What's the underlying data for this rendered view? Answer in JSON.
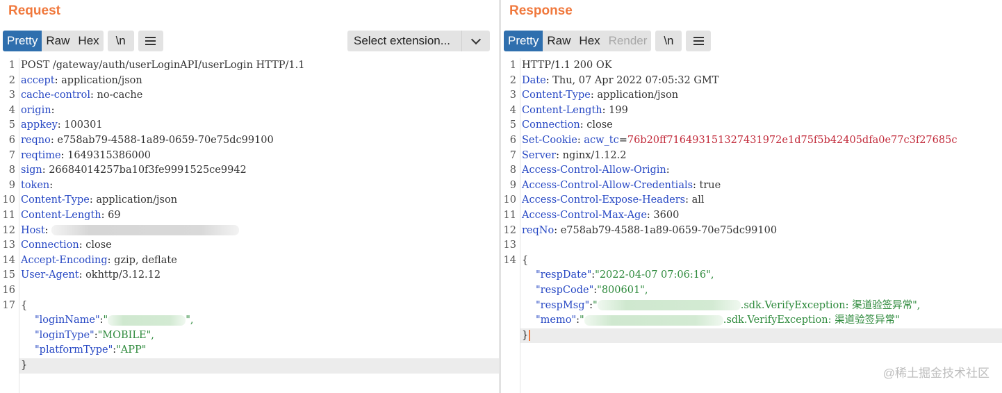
{
  "request": {
    "title": "Request",
    "tabs": [
      "Pretty",
      "Raw",
      "Hex"
    ],
    "newline_label": "\\n",
    "select_extension": "Select extension...",
    "lines": [
      {
        "n": "1",
        "text": "POST /gateway/auth/userLoginAPI/userLogin HTTP/1.1"
      },
      {
        "n": "2",
        "key": "accept",
        "val": " application/json"
      },
      {
        "n": "3",
        "key": "cache-control",
        "val": " no-cache"
      },
      {
        "n": "4",
        "key": "origin",
        "val": ""
      },
      {
        "n": "5",
        "key": "appkey",
        "val": " 100301"
      },
      {
        "n": "6",
        "key": "reqno",
        "val": " e758ab79-4588-1a89-0659-70e75dc99100"
      },
      {
        "n": "7",
        "key": "reqtime",
        "val": " 1649315386000"
      },
      {
        "n": "8",
        "key": "sign",
        "val": " 26684014257ba10f3fe9991525ce9942"
      },
      {
        "n": "9",
        "key": "token",
        "val": ""
      },
      {
        "n": "10",
        "key": "Content-Type",
        "val": " application/json"
      },
      {
        "n": "11",
        "key": "Content-Length",
        "val": " 69"
      },
      {
        "n": "12",
        "key": "Host",
        "val": " "
      },
      {
        "n": "13",
        "key": "Connection",
        "val": " close"
      },
      {
        "n": "14",
        "key": "Accept-Encoding",
        "val": " gzip, deflate"
      },
      {
        "n": "15",
        "key": "User-Agent",
        "val": " okhttp/3.12.12"
      },
      {
        "n": "16",
        "text": ""
      },
      {
        "n": "17",
        "text": "{"
      }
    ],
    "body": {
      "login_name_key": "\"loginName\"",
      "login_name_close": "\",",
      "login_type_key": "\"loginType\"",
      "login_type_val": "\"MOBILE\",",
      "platform_type_key": "\"platformType\"",
      "platform_type_val": "\"APP\"",
      "close_brace": "}",
      "colon": ":",
      "open_quote": "\""
    }
  },
  "response": {
    "title": "Response",
    "tabs": [
      "Pretty",
      "Raw",
      "Hex",
      "Render"
    ],
    "newline_label": "\\n",
    "lines": [
      {
        "n": "1",
        "text": "HTTP/1.1 200 OK"
      },
      {
        "n": "2",
        "key": "Date",
        "val": " Thu, 07 Apr 2022 07:05:32 GMT"
      },
      {
        "n": "3",
        "key": "Content-Type",
        "val": " application/json"
      },
      {
        "n": "4",
        "key": "Content-Length",
        "val": " 199"
      },
      {
        "n": "5",
        "key": "Connection",
        "val": " close"
      },
      {
        "n": "6",
        "key": "Set-Cookie",
        "cookie_name": " acw_tc",
        "cookie_val": "76b20ff716493151327431972e1d75f5b42405dfa0e77c3f27685c"
      },
      {
        "n": "7",
        "key": "Server",
        "val": " nginx/1.12.2"
      },
      {
        "n": "8",
        "key": "Access-Control-Allow-Origin",
        "val": ""
      },
      {
        "n": "9",
        "key": "Access-Control-Allow-Credentials",
        "val": " true"
      },
      {
        "n": "10",
        "key": "Access-Control-Expose-Headers",
        "val": " all"
      },
      {
        "n": "11",
        "key": "Access-Control-Max-Age",
        "val": " 3600"
      },
      {
        "n": "12",
        "key": "reqNo",
        "val": " e758ab79-4588-1a89-0659-70e75dc99100"
      },
      {
        "n": "13",
        "text": ""
      },
      {
        "n": "14",
        "text": "{"
      }
    ],
    "body": {
      "resp_date_key": "\"respDate\"",
      "resp_date_val": "\"2022-04-07 07:06:16\",",
      "resp_code_key": "\"respCode\"",
      "resp_code_val": "\"800601\",",
      "resp_msg_key": "\"respMsg\"",
      "resp_msg_val": ".sdk.VerifyException: 渠道验签异常\",",
      "memo_key": "\"memo\"",
      "memo_val": ".sdk.VerifyException: 渠道验签异常\"",
      "close_brace": "}",
      "colon": ":",
      "open_quote": "\""
    }
  },
  "watermark": "@稀土掘金技术社区"
}
